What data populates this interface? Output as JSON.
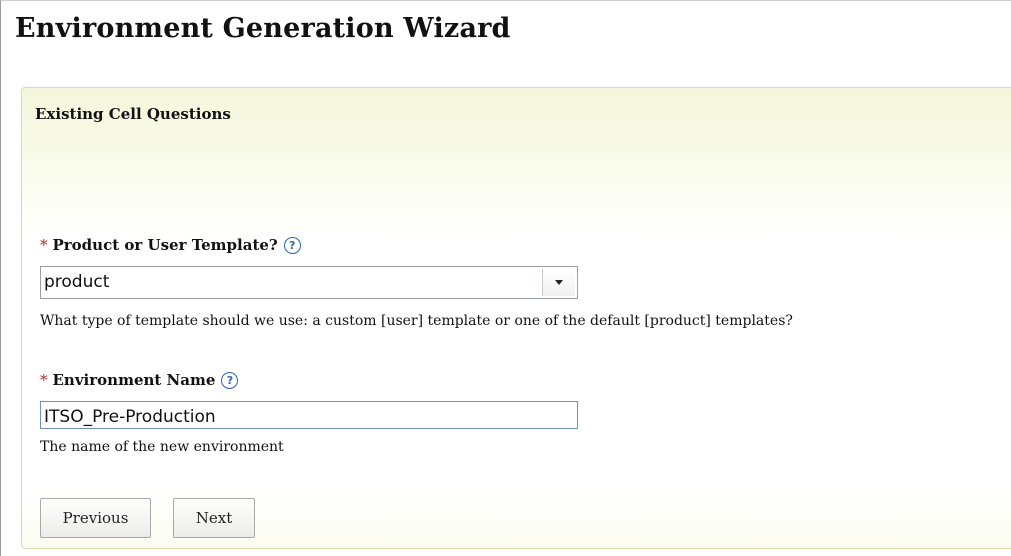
{
  "wizard": {
    "title": "Environment Generation Wizard"
  },
  "panel": {
    "heading": "Existing Cell Questions"
  },
  "fields": {
    "template": {
      "required_marker": "*",
      "label": "Product or User Template?",
      "help_icon": "question-circle-icon",
      "help_glyph": "?",
      "value": "product",
      "hint": "What type of template should we use: a custom [user] template or one of the default [product] templates?"
    },
    "environment_name": {
      "required_marker": "*",
      "label": "Environment Name",
      "help_icon": "question-circle-icon",
      "help_glyph": "?",
      "value": "ITSO_Pre-Production",
      "hint": "The name of the new environment"
    }
  },
  "buttons": {
    "previous": "Previous",
    "next": "Next"
  },
  "colors": {
    "required": "#cc2222",
    "help_icon": "#2f63b5",
    "panel_tint": "#f4f6dc"
  }
}
